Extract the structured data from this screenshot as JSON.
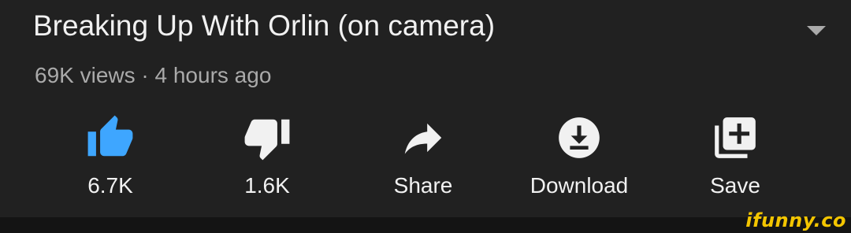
{
  "video": {
    "title": "Breaking Up With Orlin (on camera)",
    "meta": "69K views · 4 hours ago"
  },
  "actions": [
    {
      "id": "like",
      "label": "6.7K",
      "icon": "thumbs-up-icon",
      "active": true
    },
    {
      "id": "dislike",
      "label": "1.6K",
      "icon": "thumbs-down-icon"
    },
    {
      "id": "share",
      "label": "Share",
      "icon": "share-arrow-icon"
    },
    {
      "id": "download",
      "label": "Download",
      "icon": "download-icon"
    },
    {
      "id": "save",
      "label": "Save",
      "icon": "add-to-playlist-icon"
    }
  ],
  "watermark": "ifunny.co",
  "colors": {
    "background": "#212121",
    "text_primary": "#f1f1f1",
    "text_secondary": "#aaaaaa",
    "like_active": "#3ea6ff",
    "icon": "#f1f1f1",
    "watermark": "#f3c500"
  }
}
